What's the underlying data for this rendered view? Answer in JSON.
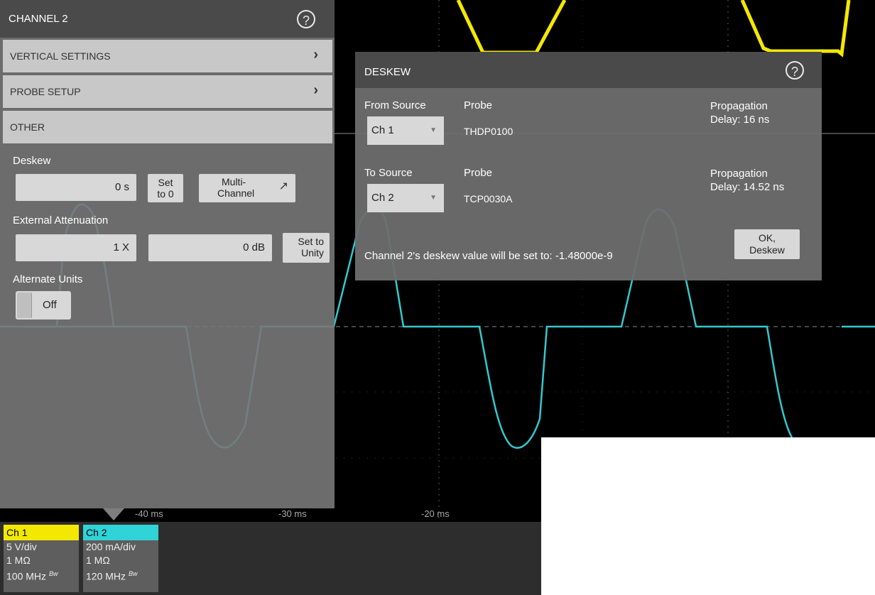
{
  "scope": {
    "time_labels": [
      "-40 ms",
      "-30 ms",
      "-20 ms"
    ],
    "colors": {
      "ch1": "#f3e800",
      "ch2": "#35c8cf",
      "grid": "#555555"
    }
  },
  "channel_panel": {
    "title": "CHANNEL 2",
    "menu": [
      {
        "label": "VERTICAL SETTINGS"
      },
      {
        "label": "PROBE SETUP"
      },
      {
        "label": "OTHER"
      }
    ],
    "deskew_label": "Deskew",
    "deskew_value": "0 s",
    "set_to_zero": [
      "Set",
      "to 0"
    ],
    "multi_channel": [
      "Multi-",
      "Channel"
    ],
    "ext_atten_label": "External Attenuation",
    "ext_atten_value": "1 X",
    "ext_atten_db": "0 dB",
    "set_to_unity": [
      "Set to",
      "Unity"
    ],
    "alt_units_label": "Alternate Units",
    "alt_units_value": "Off"
  },
  "deskew_dialog": {
    "title": "DESKEW",
    "from_source_label": "From Source",
    "from_source_value": "Ch 1",
    "from_probe_label": "Probe",
    "from_probe_value": "THDP0100",
    "from_delay": [
      "Propagation",
      "Delay: 16 ns"
    ],
    "to_source_label": "To Source",
    "to_source_value": "Ch 2",
    "to_probe_label": "Probe",
    "to_probe_value": "TCP0030A",
    "to_delay": [
      "Propagation",
      "Delay: 14.52 ns"
    ],
    "message": "Channel 2's deskew value will be set to: -1.48000e-9",
    "ok_button": [
      "OK,",
      "Deskew"
    ]
  },
  "channels": [
    {
      "name": "Ch 1",
      "scale": "5 V/div",
      "impedance": "1 MΩ",
      "bandwidth": "100 MHz",
      "bw_badge": "Bw"
    },
    {
      "name": "Ch 2",
      "scale": "200 mA/div",
      "impedance": "1 MΩ",
      "bandwidth": "120 MHz",
      "bw_badge": "Bw"
    }
  ]
}
